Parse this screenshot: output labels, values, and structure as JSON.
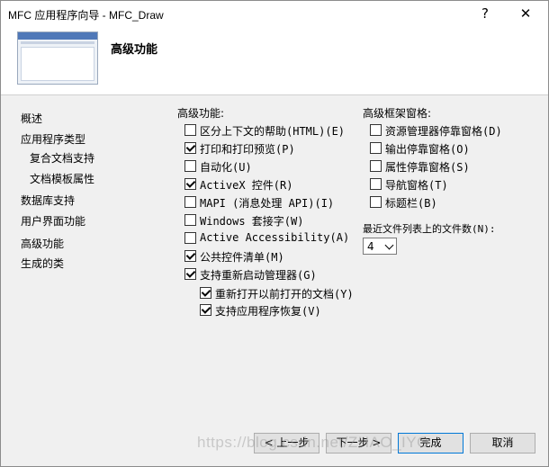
{
  "window": {
    "title": "MFC 应用程序向导 - MFC_Draw",
    "help_glyph": "?",
    "close_glyph": "✕"
  },
  "header": {
    "title": "高级功能"
  },
  "sidebar": {
    "items": [
      {
        "label": "概述"
      },
      {
        "label": "应用程序类型"
      },
      {
        "label": "复合文档支持"
      },
      {
        "label": "文档模板属性"
      },
      {
        "label": "数据库支持"
      },
      {
        "label": "用户界面功能"
      },
      {
        "label": "高级功能"
      },
      {
        "label": "生成的类"
      }
    ]
  },
  "features": {
    "group_label": "高级功能:",
    "options": [
      {
        "label": "区分上下文的帮助(HTML)(E)",
        "checked": false
      },
      {
        "label": "打印和打印预览(P)",
        "checked": true
      },
      {
        "label": "自动化(U)",
        "checked": false
      },
      {
        "label": "ActiveX 控件(R)",
        "checked": true
      },
      {
        "label": "MAPI (消息处理 API)(I)",
        "checked": false
      },
      {
        "label": "Windows 套接字(W)",
        "checked": false
      },
      {
        "label": "Active Accessibility(A)",
        "checked": false
      },
      {
        "label": "公共控件清单(M)",
        "checked": true
      },
      {
        "label": "支持重新启动管理器(G)",
        "checked": true
      },
      {
        "label": "重新打开以前打开的文档(Y)",
        "checked": true
      },
      {
        "label": "支持应用程序恢复(V)",
        "checked": true
      }
    ]
  },
  "frame_panes": {
    "group_label": "高级框架窗格:",
    "options": [
      {
        "label": "资源管理器停靠窗格(D)",
        "checked": false
      },
      {
        "label": "输出停靠窗格(O)",
        "checked": false
      },
      {
        "label": "属性停靠窗格(S)",
        "checked": false
      },
      {
        "label": "导航窗格(T)",
        "checked": false
      },
      {
        "label": "标题栏(B)",
        "checked": false
      }
    ]
  },
  "mru": {
    "label": "最近文件列表上的文件数(N):",
    "value": "4"
  },
  "buttons": {
    "prev": "< 上一步",
    "next": "下一步 >",
    "finish": "完成",
    "cancel": "取消"
  },
  "watermark": "https://blog.csdn.net/ZHAO_IYO"
}
